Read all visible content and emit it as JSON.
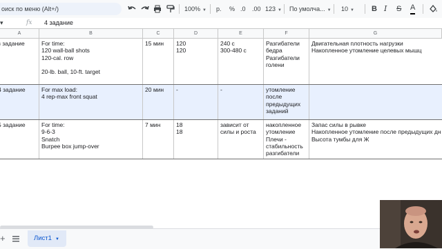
{
  "toolbar": {
    "menu_search_placeholder": "оиск по меню (Alt+/)",
    "zoom": "100%",
    "currency": "р.",
    "percent": "%",
    "decrease_decimals": ".0",
    "increase_decimals": ".00",
    "more_formats": "123",
    "font": "По умолча...",
    "font_size": "10",
    "bold": "B",
    "strikethrough": "S",
    "text_color": "A"
  },
  "formula_bar": {
    "fx": "fx",
    "value": "4 задание"
  },
  "columns": [
    "A",
    "B",
    "C",
    "D",
    "E",
    "F",
    "G"
  ],
  "rows": [
    {
      "a": "з задание",
      "b": "For time:\n120 wall-ball shots\n120-cal. row\n\n20-lb. ball, 10-ft. target",
      "c": "15 мин",
      "d": "120\n120",
      "e": "240 с\n300-480 с",
      "f": "Разгибатели\nбедра\nРазгибатели\nголени",
      "g": "Двигательная плотность нагрузки\nНакопленное утомление целевых мышц"
    },
    {
      "a": "4 задание",
      "b": "For max load:\n4 rep-max front squat",
      "c": "20 мин",
      "d": "-",
      "e": "-",
      "f": "утомление\nпосле\nпредыдущих\nзаданий",
      "g": ""
    },
    {
      "a": "5 задание",
      "b": "For time:\n9-6-3\nSnatch\nBurpee box jump-over",
      "c": "7 мин",
      "d": "18\n18",
      "e": "зависит от\nсилы и роста",
      "f": "накопленное\nутомление\nПлечи -\nстабильность\nразгибатели",
      "g": "Запас силы в рывке\nНакопленное утомление после предыдущих дн\nВысота тумбы для Ж"
    }
  ],
  "sheet_tab": "Лист1"
}
